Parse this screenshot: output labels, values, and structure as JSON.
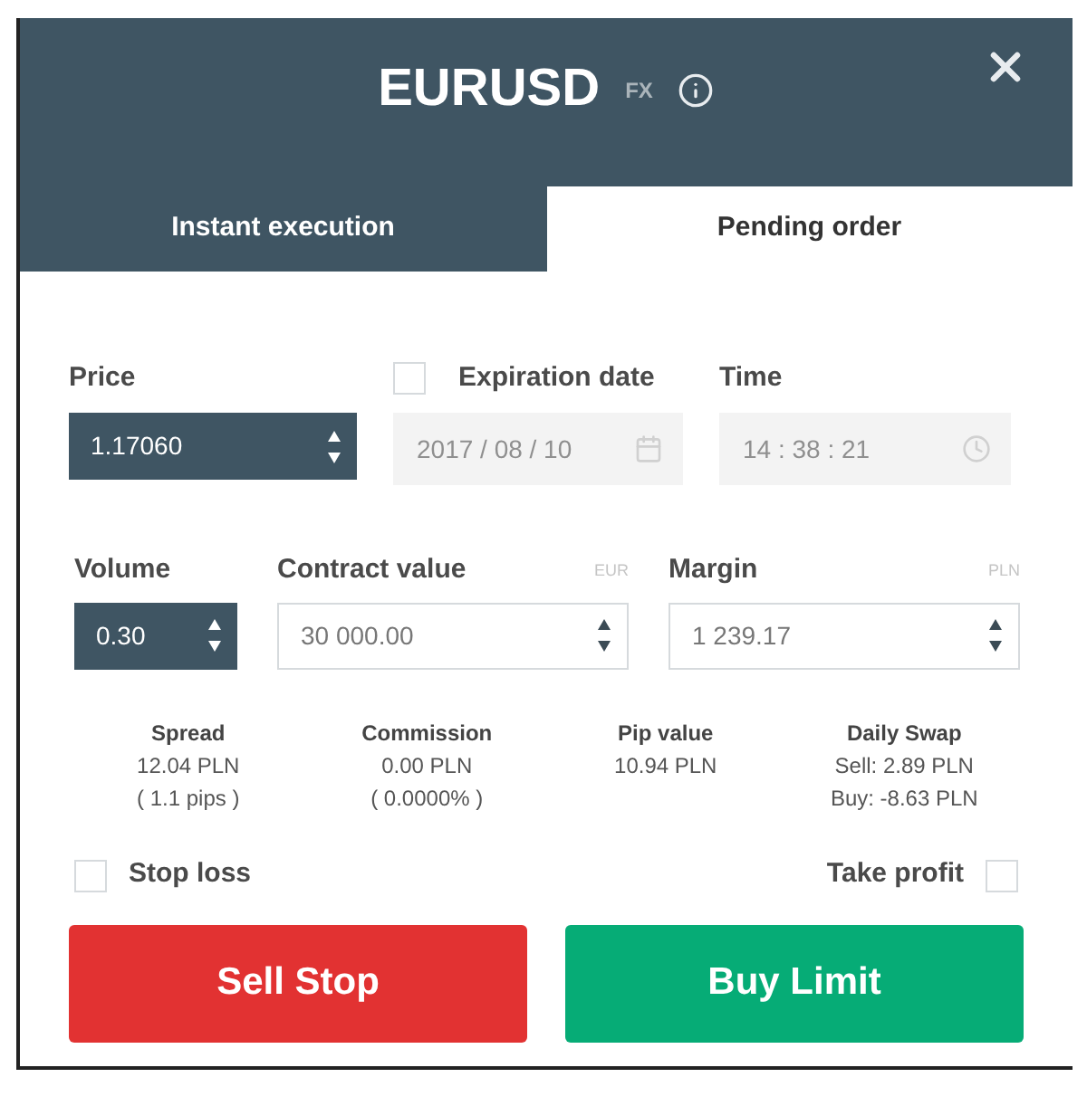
{
  "header": {
    "title": "EURUSD",
    "tag": "FX"
  },
  "tabs": [
    {
      "label": "Instant execution",
      "selected": false
    },
    {
      "label": "Pending order",
      "selected": true
    }
  ],
  "price": {
    "label": "Price",
    "value": "1.17060"
  },
  "expiration": {
    "label": "Expiration date",
    "checked": false,
    "date": {
      "value": "2017 / 08 / 10",
      "disabled": true
    },
    "time": {
      "label": "Time",
      "value": "14 : 38 : 21",
      "disabled": true
    }
  },
  "volume": {
    "label": "Volume",
    "value": "0.30"
  },
  "contract_value": {
    "label": "Contract value",
    "unit": "EUR",
    "value": "30 000.00"
  },
  "margin": {
    "label": "Margin",
    "unit": "PLN",
    "value": "1 239.17"
  },
  "stats": [
    {
      "label": "Spread",
      "lines": [
        "12.04 PLN",
        "( 1.1 pips )"
      ]
    },
    {
      "label": "Commission",
      "lines": [
        "0.00 PLN",
        "( 0.0000% )"
      ]
    },
    {
      "label": "Pip value",
      "lines": [
        "10.94 PLN"
      ]
    },
    {
      "label": "Daily Swap",
      "lines": [
        "Sell: 2.89 PLN",
        "Buy: -8.63 PLN"
      ]
    }
  ],
  "stop_loss": {
    "label": "Stop loss",
    "checked": false
  },
  "take_profit": {
    "label": "Take profit",
    "checked": false
  },
  "buttons": [
    {
      "label": "Sell Stop",
      "kind": "sell"
    },
    {
      "label": "Buy Limit",
      "kind": "buy"
    }
  ]
}
